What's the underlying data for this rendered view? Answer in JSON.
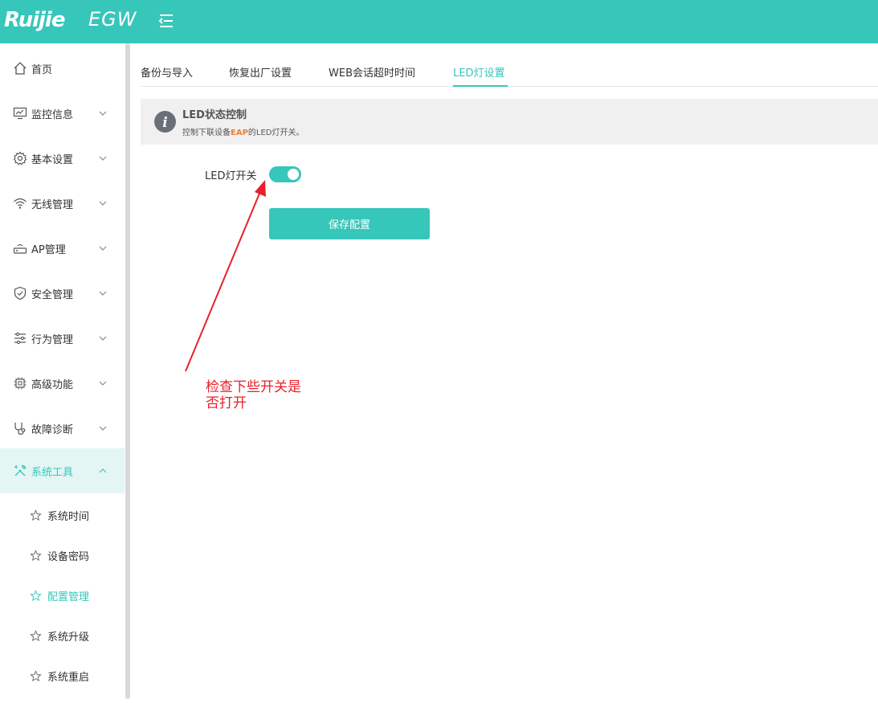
{
  "header": {
    "brand": "Ruijie",
    "product": "EGW",
    "bg_color": "#37c6ba"
  },
  "sidebar": {
    "items": [
      {
        "label": "首页",
        "icon": "home-icon",
        "expandable": false
      },
      {
        "label": "监控信息",
        "icon": "monitor-chart-icon",
        "expandable": true
      },
      {
        "label": "基本设置",
        "icon": "gear-icon",
        "expandable": true
      },
      {
        "label": "无线管理",
        "icon": "wifi-icon",
        "expandable": true
      },
      {
        "label": "AP管理",
        "icon": "access-point-icon",
        "expandable": true
      },
      {
        "label": "安全管理",
        "icon": "shield-icon",
        "expandable": true
      },
      {
        "label": "行为管理",
        "icon": "sliders-icon",
        "expandable": true
      },
      {
        "label": "高级功能",
        "icon": "chip-icon",
        "expandable": true
      },
      {
        "label": "故障诊断",
        "icon": "stethoscope-icon",
        "expandable": true
      },
      {
        "label": "系统工具",
        "icon": "tools-icon",
        "expandable": true,
        "expanded": true,
        "active": true
      }
    ],
    "sub_items": [
      {
        "label": "系统时间",
        "icon": "star-icon"
      },
      {
        "label": "设备密码",
        "icon": "star-icon"
      },
      {
        "label": "配置管理",
        "icon": "star-icon",
        "active": true
      },
      {
        "label": "系统升级",
        "icon": "star-icon"
      },
      {
        "label": "系统重启",
        "icon": "star-icon"
      }
    ]
  },
  "tabs": [
    {
      "label": "备份与导入"
    },
    {
      "label": "恢复出厂设置"
    },
    {
      "label": "WEB会话超时时间"
    },
    {
      "label": "LED灯设置",
      "active": true
    }
  ],
  "info": {
    "title": "LED状态控制",
    "desc_prefix": "控制下联设备",
    "desc_highlight": "EAP",
    "desc_suffix": "的LED灯开关。",
    "icon": "info-icon"
  },
  "form": {
    "led_switch_label": "LED灯开关",
    "led_switch_on": true,
    "save_label": "保存配置"
  },
  "annotation": {
    "line1": "检查下些开关是",
    "line2": "否打开",
    "color": "#e8202a"
  },
  "colors": {
    "accent": "#37c6ba",
    "highlight": "#f07c3c"
  }
}
